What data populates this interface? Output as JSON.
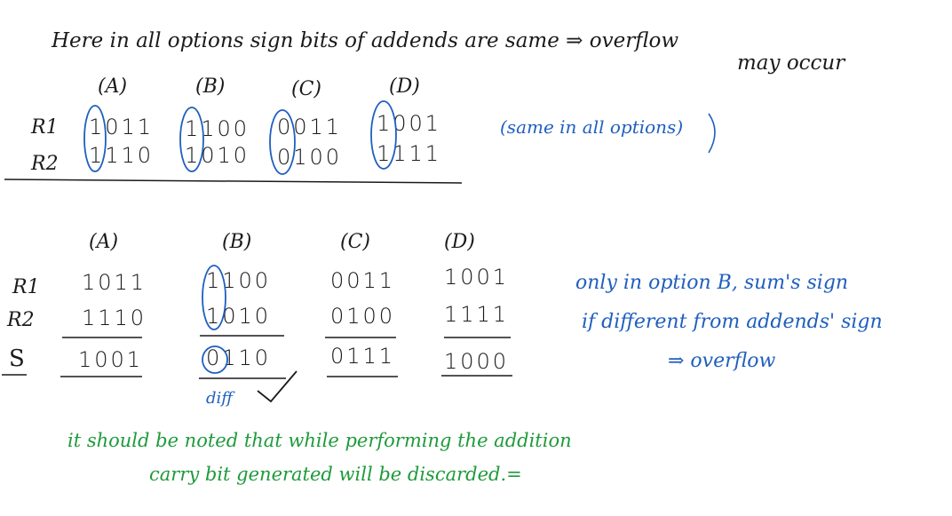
{
  "intro": {
    "line1": "Here in all options sign bits of addends are same ⇒ overflow",
    "line2": "may occur"
  },
  "top": {
    "headers": [
      "(A)",
      "(B)",
      "(C)",
      "(D)"
    ],
    "r1_label": "R1",
    "r2_label": "R2",
    "r1": [
      "1011",
      "1100",
      "0011",
      "1001"
    ],
    "r2": [
      "1110",
      "1010",
      "0100",
      "1111"
    ],
    "note": "(same in all options)"
  },
  "bottom": {
    "headers": [
      "(A)",
      "(B)",
      "(C)",
      "(D)"
    ],
    "r1_label": "R1",
    "r2_label": "R2",
    "s_label": "S",
    "r1": [
      "1011",
      "1100",
      "0011",
      "1001"
    ],
    "r2": [
      "1110",
      "1010",
      "0100",
      "1111"
    ],
    "sum": [
      "1001",
      "0110",
      "0111",
      "1000"
    ],
    "diff": "diff",
    "check": "✓"
  },
  "explain": {
    "line1": "only in option B, sum's sign",
    "line2": "if different from addends' sign",
    "line3": "⇒ overflow"
  },
  "footer": {
    "line1": "it should be noted that while performing the addition",
    "line2": "carry bit generated will be discarded.="
  }
}
